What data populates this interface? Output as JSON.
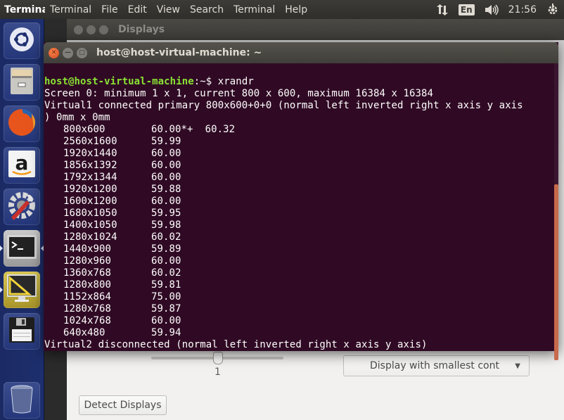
{
  "top_panel": {
    "app_title": "Terminal",
    "menu": [
      "Terminal",
      "File",
      "Edit",
      "View",
      "Search",
      "Terminal",
      "Help"
    ],
    "indicators": {
      "network_icon": "network-updown-icon",
      "keyboard_layout": "En",
      "sound_icon": "volume-icon",
      "clock": "21:56",
      "session_icon": "power-gear-icon"
    }
  },
  "launcher": {
    "items": [
      {
        "name": "dash-home",
        "icon": "ubuntu-logo-icon"
      },
      {
        "name": "files",
        "icon": "file-cabinet-icon"
      },
      {
        "name": "firefox",
        "icon": "firefox-icon"
      },
      {
        "name": "amazon",
        "icon": "amazon-icon"
      },
      {
        "name": "system-settings",
        "icon": "settings-wrench-icon"
      },
      {
        "name": "terminal",
        "icon": "terminal-icon",
        "active": true
      },
      {
        "name": "displays",
        "icon": "displays-ruler-icon",
        "running": true
      },
      {
        "name": "save-drive",
        "icon": "floppy-disk-icon"
      },
      {
        "name": "trash",
        "icon": "trash-icon"
      }
    ]
  },
  "displays_window": {
    "title": "Displays",
    "scale": {
      "value_label": "1",
      "fraction": 0.5
    },
    "launcher_placement": {
      "selected": "Display with smallest cont"
    },
    "detect_button": "Detect Displays"
  },
  "terminal": {
    "title": "host@host-virtual-machine: ~",
    "prompt": {
      "user_host": "host@host-virtual-machine",
      "path": ":~",
      "symbol": "$ ",
      "command": "xrandr"
    },
    "output_lines": [
      "Screen 0: minimum 1 x 1, current 800 x 600, maximum 16384 x 16384",
      "Virtual1 connected primary 800x600+0+0 (normal left inverted right x axis y axis",
      ") 0mm x 0mm"
    ],
    "modes": [
      {
        "res": "800x600",
        "rates": "60.00*+  60.32"
      },
      {
        "res": "2560x1600",
        "rates": "59.99"
      },
      {
        "res": "1920x1440",
        "rates": "60.00"
      },
      {
        "res": "1856x1392",
        "rates": "60.00"
      },
      {
        "res": "1792x1344",
        "rates": "60.00"
      },
      {
        "res": "1920x1200",
        "rates": "59.88"
      },
      {
        "res": "1600x1200",
        "rates": "60.00"
      },
      {
        "res": "1680x1050",
        "rates": "59.95"
      },
      {
        "res": "1400x1050",
        "rates": "59.98"
      },
      {
        "res": "1280x1024",
        "rates": "60.02"
      },
      {
        "res": "1440x900",
        "rates": "59.89"
      },
      {
        "res": "1280x960",
        "rates": "60.00"
      },
      {
        "res": "1360x768",
        "rates": "60.02"
      },
      {
        "res": "1280x800",
        "rates": "59.81"
      },
      {
        "res": "1152x864",
        "rates": "75.00"
      },
      {
        "res": "1280x768",
        "rates": "59.87"
      },
      {
        "res": "1024x768",
        "rates": "60.00"
      },
      {
        "res": "640x480",
        "rates": "59.94"
      }
    ],
    "final_line": "Virtual2 disconnected (normal left inverted right x axis y axis)"
  }
}
